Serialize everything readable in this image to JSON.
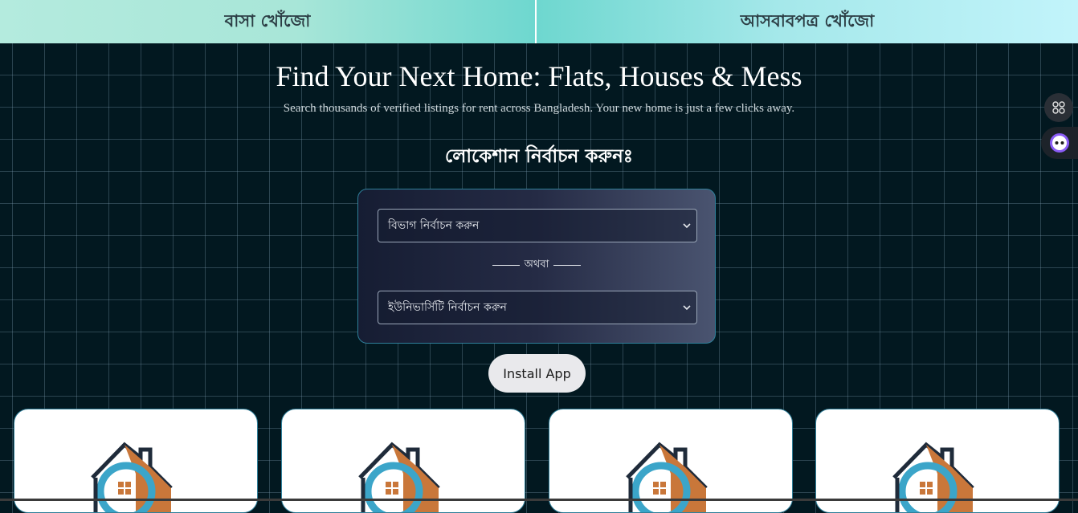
{
  "tabs": [
    {
      "label": "বাসা খোঁজো"
    },
    {
      "label": "আসবাবপত্র খোঁজো"
    }
  ],
  "hero": {
    "title": "Find Your Next Home: Flats, Houses & Mess",
    "subtitle": "Search thousands of verified listings for rent across Bangladesh. Your new home is just a few clicks away."
  },
  "location": {
    "title": "লোকেশান নির্বাচন করুনঃ",
    "division_select": "বিভাগ নির্বাচন করুন",
    "or_label": "অথবা",
    "university_select": "ইউনিভার্সিটি নির্বাচন করুন"
  },
  "install_label": "Install App",
  "cards_count_visible": 4,
  "icons": {
    "select_chevron": "chevron-down-icon",
    "side_apps": "apps-grid-icon",
    "side_bot": "assistant-bot-icon",
    "card_logo": "house-logo-icon"
  },
  "colors": {
    "background": "#021820",
    "panel_border": "#2f7f9a",
    "logo_roof": "#c9773a",
    "logo_ring": "#3ba5c9",
    "logo_dark": "#1f2b3a"
  }
}
